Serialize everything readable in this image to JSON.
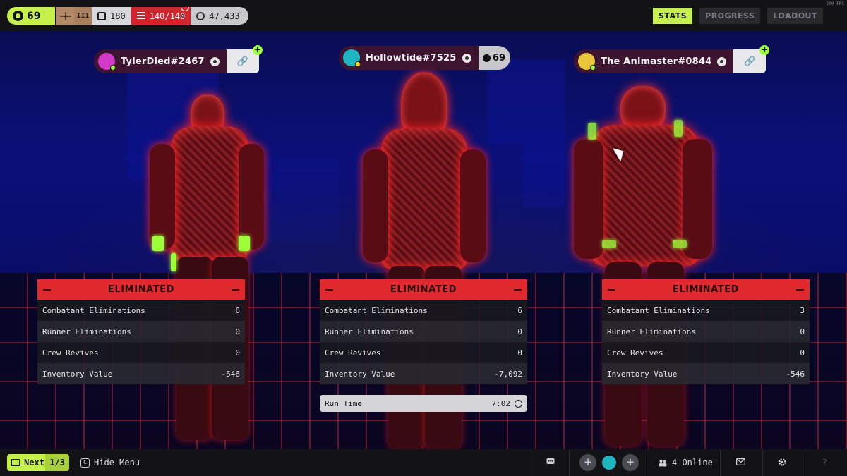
{
  "topbar": {
    "level": "69",
    "rank_roman": "III",
    "vault": "180",
    "inventory": "140/140",
    "credits": "47,433",
    "fps": "200 FPS",
    "tabs": [
      {
        "label": "STATS",
        "active": true
      },
      {
        "label": "PROGRESS",
        "active": false
      },
      {
        "label": "LOADOUT",
        "active": false
      }
    ]
  },
  "players": [
    {
      "name": "TylerDied#2467",
      "status": "ELIMINATED",
      "stats": [
        {
          "label": "Combatant Eliminations",
          "value": "6"
        },
        {
          "label": "Runner Eliminations",
          "value": "0"
        },
        {
          "label": "Crew Revives",
          "value": "0"
        },
        {
          "label": "Inventory Value",
          "value": "-546"
        }
      ]
    },
    {
      "name": "Hollowtide#7525",
      "level": "69",
      "status": "ELIMINATED",
      "stats": [
        {
          "label": "Combatant Eliminations",
          "value": "6"
        },
        {
          "label": "Runner Eliminations",
          "value": "0"
        },
        {
          "label": "Crew Revives",
          "value": "0"
        },
        {
          "label": "Inventory Value",
          "value": "-7,092"
        }
      ],
      "run_time_label": "Run Time",
      "run_time": "7:02"
    },
    {
      "name": "The Animaster#0844",
      "status": "ELIMINATED",
      "stats": [
        {
          "label": "Combatant Eliminations",
          "value": "3"
        },
        {
          "label": "Runner Eliminations",
          "value": "0"
        },
        {
          "label": "Crew Revives",
          "value": "0"
        },
        {
          "label": "Inventory Value",
          "value": "-546"
        }
      ]
    }
  ],
  "bottombar": {
    "next_label": "Next",
    "next_count": "1/3",
    "hide_key": "C",
    "hide_label": "Hide Menu",
    "online": "4 Online"
  },
  "colors": {
    "accent": "#c6f14a",
    "eliminated": "#e02a2e",
    "inventory_full": "#d1242c"
  }
}
